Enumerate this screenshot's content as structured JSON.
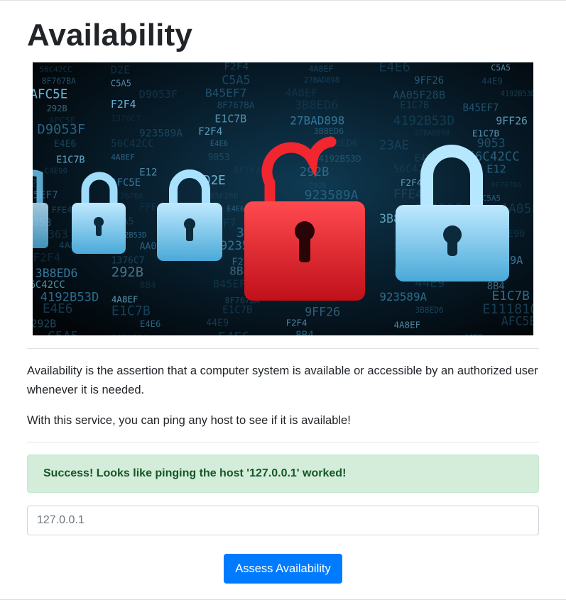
{
  "page": {
    "title": "Availability",
    "description": "Availability is the assertion that a computer system is available or accessible by an authorized user whenever it is needed.",
    "service_text": "With this service, you can ping any host to see if it is available!"
  },
  "alert": {
    "message": "Success! Looks like pinging the host '127.0.0.1' worked!",
    "color": "#155724",
    "background": "#d4edda"
  },
  "form": {
    "host_placeholder": "127.0.0.1",
    "host_value": "",
    "submit_label": "Assess Availability",
    "button_color": "#007bff"
  },
  "hero_image": {
    "icon": "padlock-icon",
    "background_glyphs": [
      "3B8ED6",
      "292B",
      "E12",
      "44E9",
      "F2F4",
      "8B4",
      "C5A5",
      "23AE",
      "E1118107",
      "8F767BA",
      "D9053F",
      "E1C7B",
      "FFE4",
      "A37363",
      "56C42CC",
      "E4E6",
      "1376C7",
      "9053",
      "27BAD898",
      "4192B53D",
      "923589A",
      "D2E",
      "AA05F28B",
      "9FF26",
      "AFC5E",
      "C4E90",
      "B45EF7",
      "4A8EF"
    ],
    "accent_locked": "#4fb3e0",
    "accent_unlocked": "#e8202a"
  }
}
